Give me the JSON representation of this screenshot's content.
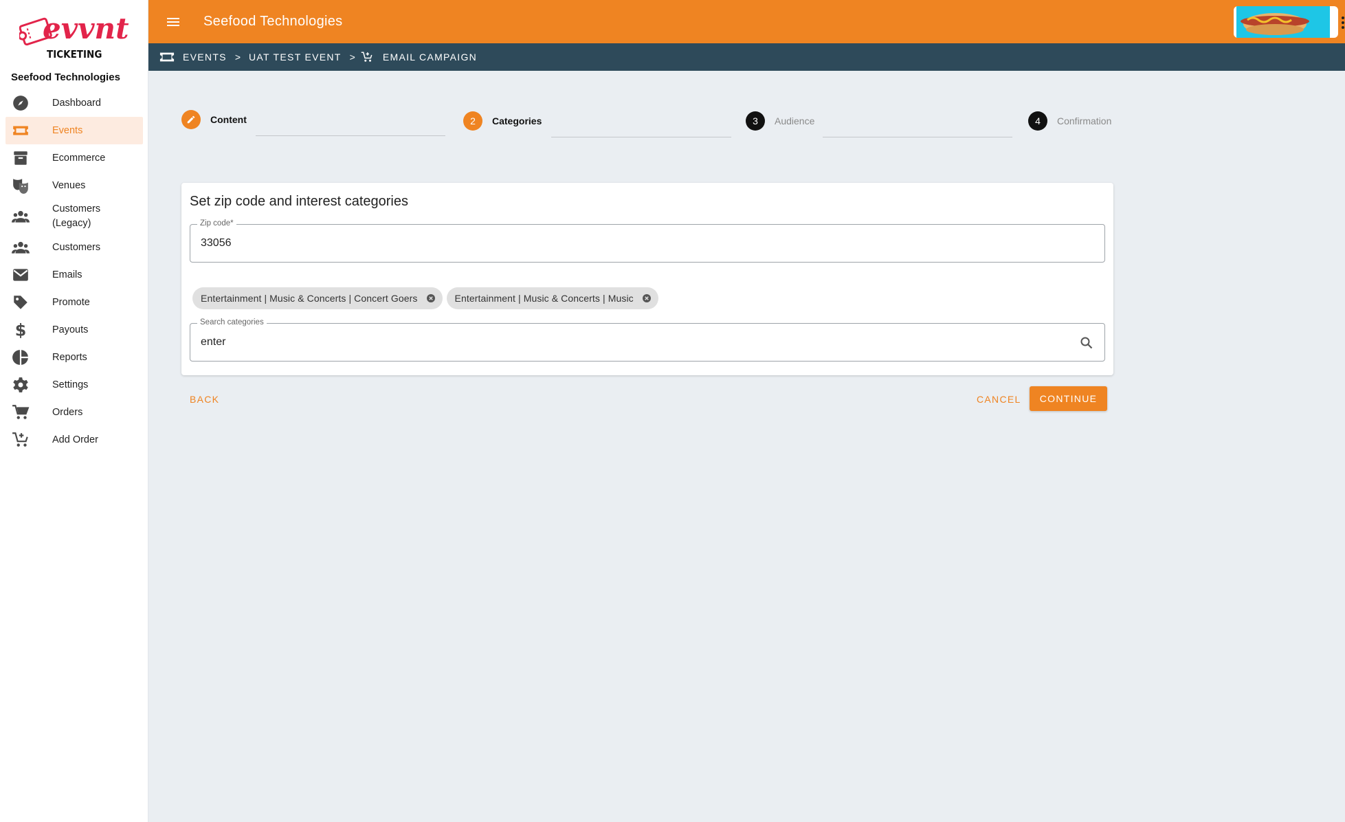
{
  "brand": {
    "accent": "#ef8422",
    "crumb_bg": "#2e4a5a",
    "logo_color": "#e2244a",
    "logo_text": "evvnt",
    "logo_sub": "TICKETING"
  },
  "sidebar": {
    "org_name": "Seefood Technologies",
    "items": [
      {
        "label": "Dashboard",
        "icon": "compass-icon"
      },
      {
        "label": "Events",
        "icon": "ticket-icon",
        "active": true
      },
      {
        "label": "Ecommerce",
        "icon": "archive-box-icon"
      },
      {
        "label": "Venues",
        "icon": "theater-masks-icon"
      },
      {
        "label": "Customers\n(Legacy)",
        "icon": "users-icon"
      },
      {
        "label": "Customers",
        "icon": "users-icon"
      },
      {
        "label": "Emails",
        "icon": "envelope-icon"
      },
      {
        "label": "Promote",
        "icon": "tag-icon"
      },
      {
        "label": "Payouts",
        "icon": "dollar-icon"
      },
      {
        "label": "Reports",
        "icon": "pie-chart-icon"
      },
      {
        "label": "Settings",
        "icon": "gear-icon"
      },
      {
        "label": "Orders",
        "icon": "cart-icon"
      },
      {
        "label": "Add Order",
        "icon": "cart-plus-icon"
      }
    ]
  },
  "header": {
    "title": "Seefood Technologies",
    "avatar_icon": "hotdog-image"
  },
  "breadcrumb": {
    "events": "EVENTS",
    "sep1": ">",
    "event": "UAT TEST EVENT",
    "sep2": ">",
    "page": "EMAIL CAMPAIGN"
  },
  "stepper": {
    "steps": [
      {
        "label": "Content",
        "state": "completed",
        "icon": "pencil-icon"
      },
      {
        "number": "2",
        "label": "Categories",
        "state": "active"
      },
      {
        "number": "3",
        "label": "Audience",
        "state": "pending"
      },
      {
        "number": "4",
        "label": "Confirmation",
        "state": "pending"
      }
    ]
  },
  "form": {
    "title": "Set zip code and interest categories",
    "zip": {
      "label": "Zip code*",
      "value": "33056"
    },
    "chips": [
      "Entertainment | Music & Concerts | Concert Goers",
      "Entertainment | Music & Concerts | Music"
    ],
    "search": {
      "label": "Search categories",
      "value": "enter"
    }
  },
  "actions": {
    "back": "BACK",
    "cancel": "CANCEL",
    "continue": "CONTINUE"
  }
}
